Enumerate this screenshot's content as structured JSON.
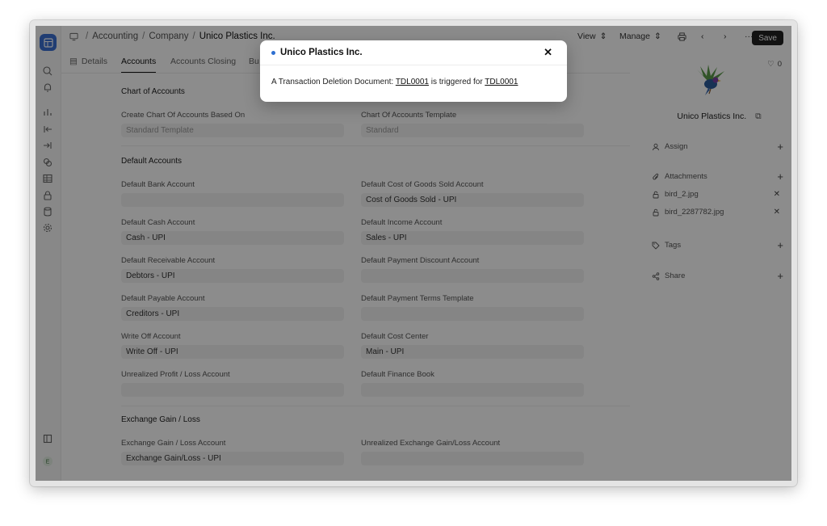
{
  "breadcrumbs": [
    "Accounting",
    "Company",
    "Unico Plastics Inc."
  ],
  "toolbar": {
    "view": "View",
    "manage": "Manage",
    "save": "Save"
  },
  "tabs": [
    "Details",
    "Accounts",
    "Accounts Closing",
    "Bu"
  ],
  "sections": {
    "chart_of_accounts": "Chart of Accounts",
    "default_accounts": "Default Accounts",
    "exchange": "Exchange Gain / Loss"
  },
  "fields": {
    "create_coa_label": "Create Chart Of Accounts Based On",
    "create_coa_value": "Standard Template",
    "coa_template_label": "Chart Of Accounts Template",
    "coa_template_value": "Standard",
    "bank_label": "Default Bank Account",
    "bank_value": "",
    "cogs_label": "Default Cost of Goods Sold Account",
    "cogs_value": "Cost of Goods Sold - UPI",
    "cash_label": "Default Cash Account",
    "cash_value": "Cash - UPI",
    "income_label": "Default Income Account",
    "income_value": "Sales - UPI",
    "receivable_label": "Default Receivable Account",
    "receivable_value": "Debtors - UPI",
    "payment_discount_label": "Default Payment Discount Account",
    "payment_discount_value": "",
    "payable_label": "Default Payable Account",
    "payable_value": "Creditors - UPI",
    "payment_terms_label": "Default Payment Terms Template",
    "payment_terms_value": "",
    "write_off_label": "Write Off Account",
    "write_off_value": "Write Off - UPI",
    "cost_center_label": "Default Cost Center",
    "cost_center_value": "Main - UPI",
    "unrealized_pl_label": "Unrealized Profit / Loss Account",
    "unrealized_pl_value": "",
    "finance_book_label": "Default Finance Book",
    "finance_book_value": "",
    "exchange_gl_label": "Exchange Gain / Loss Account",
    "exchange_gl_value": "Exchange Gain/Loss - UPI",
    "unrealized_exchange_label": "Unrealized Exchange Gain/Loss Account",
    "unrealized_exchange_value": ""
  },
  "side": {
    "likes": "0",
    "company_name": "Unico Plastics Inc.",
    "assign": "Assign",
    "attachments": "Attachments",
    "files": [
      "bird_2.jpg",
      "bird_2287782.jpg"
    ],
    "tags": "Tags",
    "share": "Share"
  },
  "modal": {
    "title": "Unico Plastics Inc.",
    "text_before": "A Transaction Deletion Document:",
    "link1": "TDL0001",
    "text_middle": "is triggered for",
    "link2": "TDL0001",
    "close_glyph": "✕"
  },
  "colors": {
    "accent": "#3b6fd1",
    "overlay": "rgba(0,0,0,0.45)",
    "save_bg": "#222222"
  }
}
